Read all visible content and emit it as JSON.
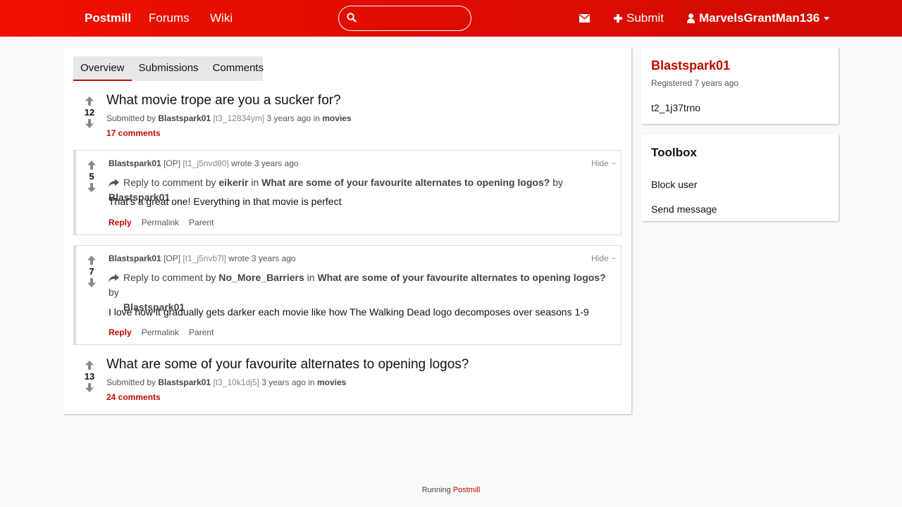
{
  "nav": {
    "brand": "Postmill",
    "links": [
      "Forums",
      "Wiki"
    ],
    "search_value": "",
    "submit_label": "Submit",
    "username": "MarvelsGrantMan136",
    "accent": "#e00d00"
  },
  "tabs": [
    {
      "label": "Overview",
      "active": true
    },
    {
      "label": "Submissions",
      "active": false
    },
    {
      "label": "Comments",
      "active": false
    }
  ],
  "items": [
    {
      "kind": "submission",
      "score": "12",
      "title": "What movie trope are you a sucker for?",
      "submitted_by_label": "Submitted by",
      "author": "Blastspark01",
      "fullname": "[t3_12834ym]",
      "time": "3 years ago",
      "in_label": "in",
      "forum": "movies",
      "comments": "17 comments"
    },
    {
      "kind": "comment",
      "score": "5",
      "author": "Blastspark01",
      "op": "[OP]",
      "fullname": "[t1_j5nvd80]",
      "wrote": "wrote 3 years ago",
      "hide": "Hide −",
      "reply_prefix": "Reply to comment by",
      "reply_user": "eikerir",
      "in_label": "in",
      "post_title": "What are some of your favourite alternates to opening logos?",
      "by_label": "by",
      "post_author": "Blastspark01",
      "body": "That’s a great one! Everything in that movie is perfect",
      "actions": {
        "reply": "Reply",
        "permalink": "Permalink",
        "parent": "Parent"
      }
    },
    {
      "kind": "comment",
      "score": "7",
      "author": "Blastspark01",
      "op": "[OP]",
      "fullname": "[t1_j5nvb7l]",
      "wrote": "wrote 3 years ago",
      "hide": "Hide −",
      "reply_prefix": "Reply to comment by",
      "reply_user": "No_More_Barriers",
      "in_label": "in",
      "post_title": "What are some of your favourite alternates to opening logos?",
      "by_label": "by",
      "post_author": "Blastspark01",
      "body": "I love how it gradually gets darker each movie like how The Walking Dead logo decomposes over seasons 1-9",
      "actions": {
        "reply": "Reply",
        "permalink": "Permalink",
        "parent": "Parent"
      }
    },
    {
      "kind": "submission",
      "score": "13",
      "title": "What are some of your favourite alternates to opening logos?",
      "submitted_by_label": "Submitted by",
      "author": "Blastspark01",
      "fullname": "[t3_10k1dj5]",
      "time": "3 years ago",
      "in_label": "in",
      "forum": "movies",
      "comments": "24 comments"
    }
  ],
  "sidebar": {
    "username": "Blastspark01",
    "registered": "Registered 7 years ago",
    "user_id": "t2_1j37trno",
    "toolbox_title": "Toolbox",
    "tools": [
      "Block user",
      "Send message"
    ]
  },
  "footer": {
    "running": "Running",
    "link": "Postmill"
  }
}
